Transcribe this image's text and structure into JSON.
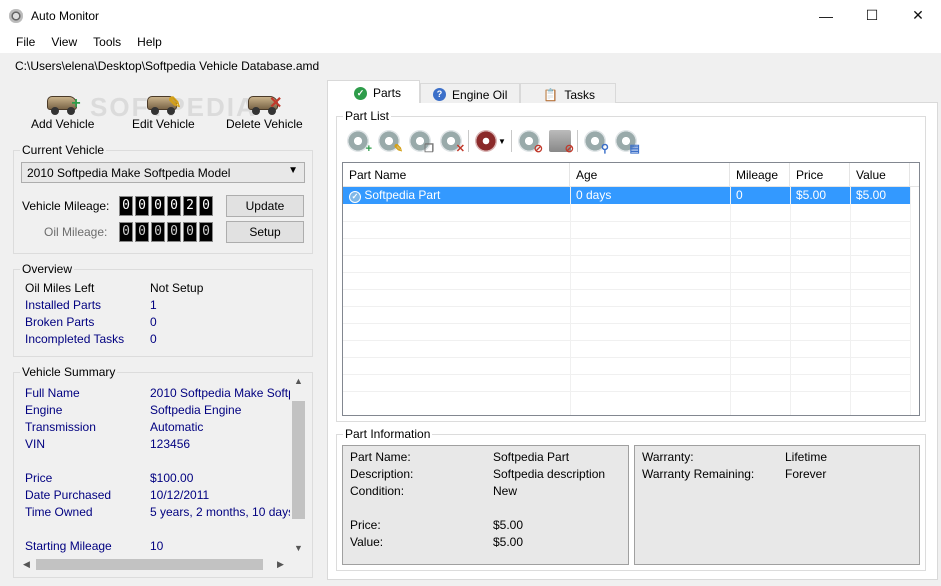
{
  "window": {
    "title": "Auto Monitor",
    "minimize": "—",
    "maximize": "☐",
    "close": "✕"
  },
  "menu": [
    "File",
    "View",
    "Tools",
    "Help"
  ],
  "file_path": "C:\\Users\\elena\\Desktop\\Softpedia Vehicle Database.amd",
  "toolbar": {
    "add": "Add Vehicle",
    "edit": "Edit Vehicle",
    "delete": "Delete Vehicle",
    "watermark": "SOFTPEDIA"
  },
  "current_vehicle": {
    "title": "Current Vehicle",
    "selected": "2010 Softpedia Make Softpedia Model",
    "vehicle_mileage_label": "Vehicle Mileage:",
    "vehicle_mileage_digits": [
      "0",
      "0",
      "0",
      "0",
      "2",
      "0"
    ],
    "oil_mileage_label": "Oil Mileage:",
    "oil_mileage_digits": [
      "0",
      "0",
      "0",
      "0",
      "0",
      "0"
    ],
    "update_button": "Update",
    "setup_button": "Setup"
  },
  "overview": {
    "title": "Overview",
    "rows": [
      {
        "key": "Oil Miles Left",
        "value": "Not Setup"
      },
      {
        "key": "Installed Parts",
        "value": "1"
      },
      {
        "key": "Broken Parts",
        "value": "0"
      },
      {
        "key": "Incompleted Tasks",
        "value": "0"
      }
    ]
  },
  "vehicle_summary": {
    "title": "Vehicle Summary",
    "rows": [
      {
        "key": "Full Name",
        "value": "2010 Softpedia Make Softp..."
      },
      {
        "key": "Engine",
        "value": "Softpedia Engine"
      },
      {
        "key": "Transmission",
        "value": "Automatic"
      },
      {
        "key": "VIN",
        "value": "123456"
      },
      {
        "key": "Price",
        "value": "$100.00"
      },
      {
        "key": "Date Purchased",
        "value": "10/12/2011"
      },
      {
        "key": "Time Owned",
        "value": "5 years, 2 months, 10 days"
      },
      {
        "key": "Starting Mileage",
        "value": "10"
      }
    ]
  },
  "tabs": [
    "Parts",
    "Engine Oil",
    "Tasks"
  ],
  "part_list": {
    "title": "Part List",
    "columns": [
      "Part Name",
      "Age",
      "Mileage",
      "Price",
      "Value"
    ],
    "rows": [
      [
        "Softpedia Part",
        "0 days",
        "0",
        "$5.00",
        "$5.00"
      ]
    ]
  },
  "part_information": {
    "title": "Part Information",
    "left": [
      {
        "key": "Part Name:",
        "value": "Softpedia Part"
      },
      {
        "key": "Description:",
        "value": "Softpedia description"
      },
      {
        "key": "Condition:",
        "value": "New"
      },
      {
        "key": "Price:",
        "value": "$5.00"
      },
      {
        "key": "Value:",
        "value": "$5.00"
      }
    ],
    "right": [
      {
        "key": "Warranty:",
        "value": "Lifetime"
      },
      {
        "key": "Warranty Remaining:",
        "value": "Forever"
      }
    ]
  },
  "colors": {
    "selection": "#3399ff",
    "key_text": "#000080",
    "check": "#2e9c4a"
  }
}
